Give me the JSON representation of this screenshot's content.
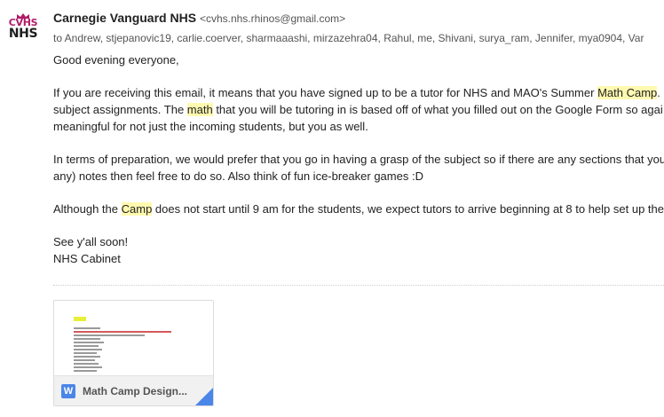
{
  "sender": {
    "avatar_top": "CVHS",
    "avatar_bottom": "NHS",
    "name": "Carnegie Vanguard NHS",
    "email": "<cvhs.nhs.rhinos@gmail.com>",
    "recipients": "to Andrew, stjepanovic19, carlie.coerver, sharmaaashi, mirzazehra04, Rahul, me, Shivani, surya_ram, Jennifer, mya0904, Var"
  },
  "body": {
    "greeting": "Good evening everyone,",
    "p1": {
      "l1_a": "If you are receiving this email, it means that you have signed up to be a tutor for NHS and MAO's Summer ",
      "l1_hl": "Math Camp",
      "l1_b": ".",
      "l2_a": "subject assignments. The ",
      "l2_hl": "math",
      "l2_b": " that you will be tutoring in is based off of what you filled out on the Google Form so agai",
      "l3": "meaningful for not just the incoming students, but you as well."
    },
    "p2": {
      "l1": "In terms of preparation, we would prefer that you go in having a grasp of the subject so if there are any sections that you",
      "l2": "any) notes then feel free to do so. Also think of fun ice-breaker games :D"
    },
    "p3": {
      "a": "Although the ",
      "hl": "Camp",
      "b": " does not start until 9 am for the students, we expect tutors to arrive beginning at 8 to help set up the"
    },
    "sig1": "See y'all soon!",
    "sig2": "NHS Cabinet"
  },
  "attachment": {
    "icon_letter": "W",
    "name": "Math Camp Design..."
  },
  "colors": {
    "highlight": "#fff9b0",
    "word_blue": "#4a86e8",
    "avatar_magenta": "#b01c67"
  }
}
